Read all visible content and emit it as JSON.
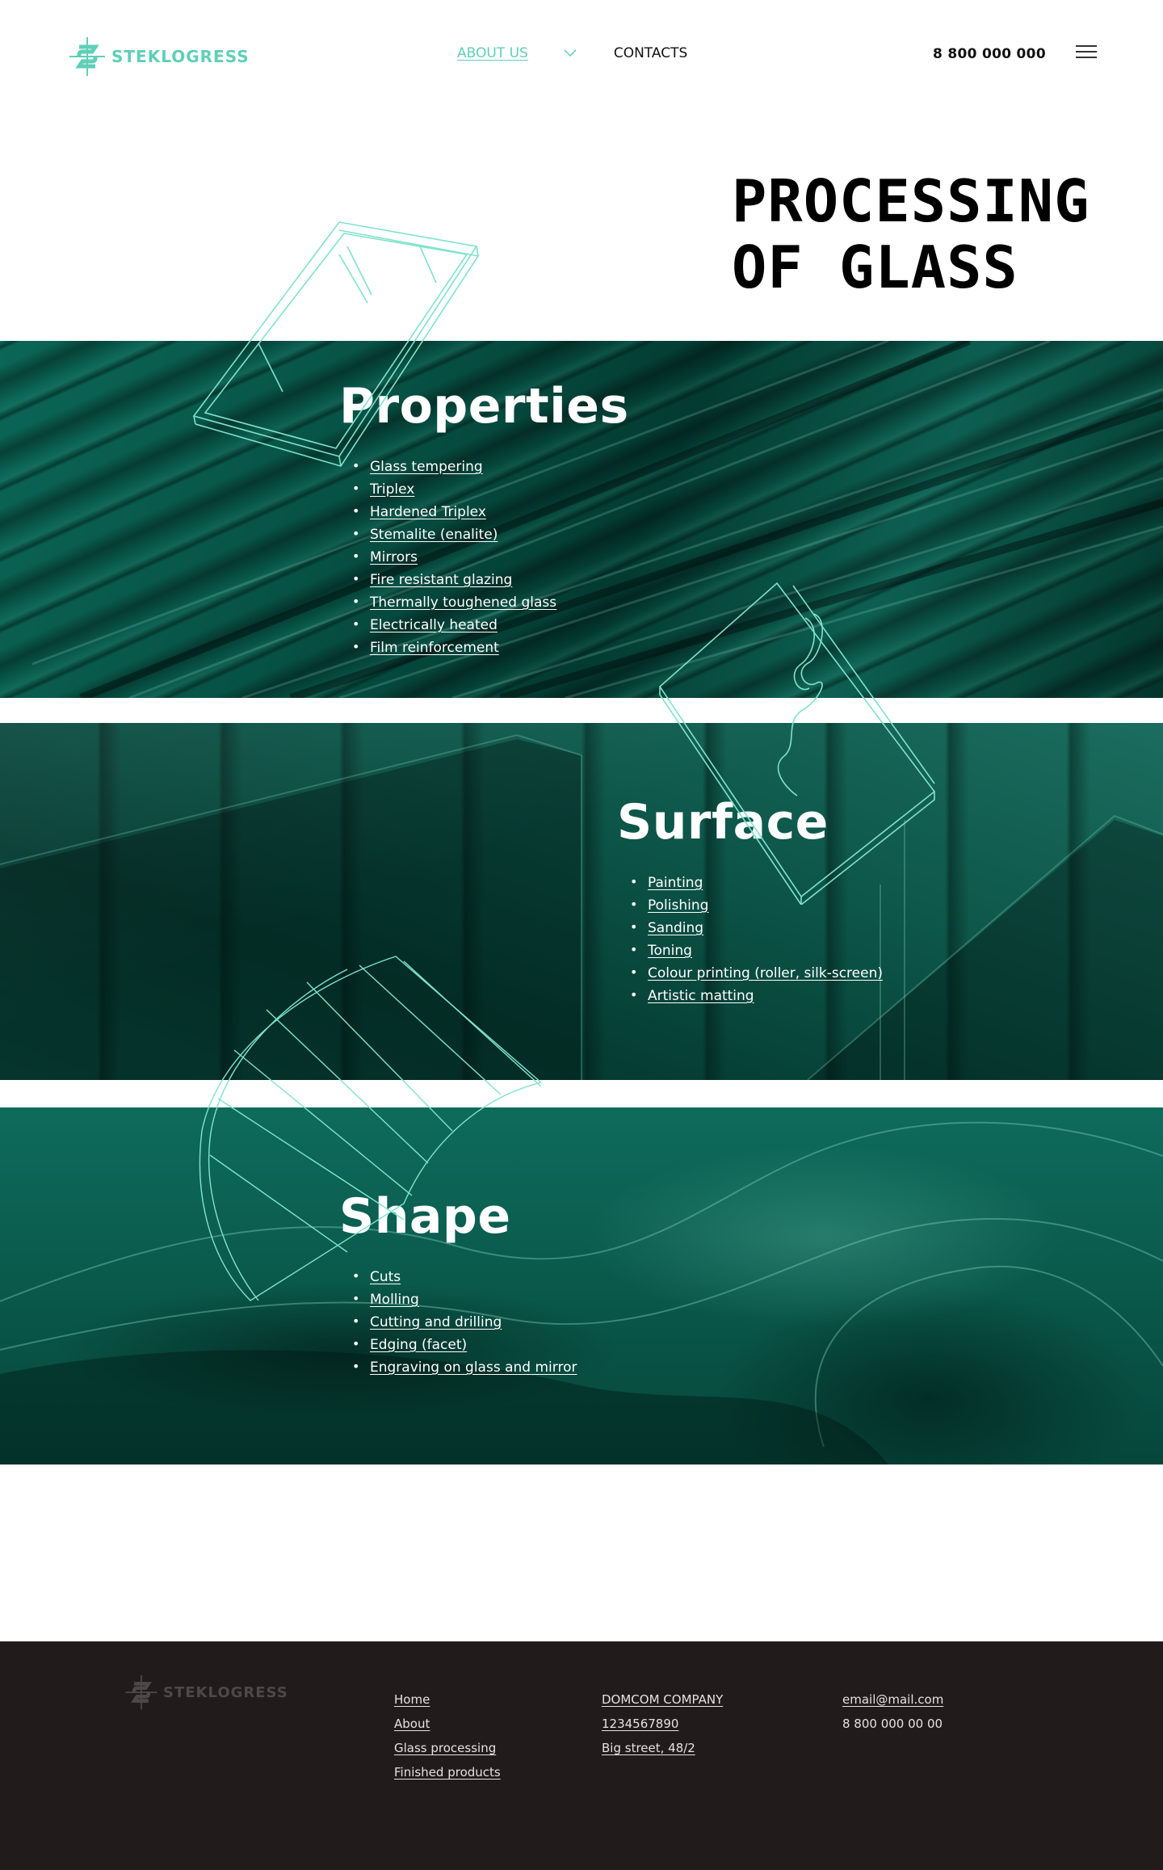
{
  "header": {
    "logo_text": "STEKLOGRESS",
    "nav": {
      "about_label": "ABOUT US",
      "contacts_label": "CONTACTS"
    },
    "phone": "8 800 000 000",
    "menu_icon": "hamburger-icon"
  },
  "hero": {
    "title_line1": "PROCESSING",
    "title_line2": "OF GLASS"
  },
  "sections": {
    "properties": {
      "title": "Properties",
      "items": [
        "Glass tempering",
        "Triplex",
        "Hardened Triplex",
        "Stemalite (enalite)",
        "Mirrors",
        "Fire resistant glazing",
        "Thermally toughened glass",
        "Electrically heated",
        "Film reinforcement"
      ]
    },
    "surface": {
      "title": "Surface",
      "items": [
        "Painting",
        "Polishing",
        "Sanding",
        "Toning",
        "Colour printing (roller, silk-screen)",
        "Artistic matting"
      ]
    },
    "shape": {
      "title": "Shape",
      "items": [
        "Cuts",
        "Molling",
        "Cutting and drilling",
        "Edging (facet)",
        "Engraving on glass and mirror"
      ]
    }
  },
  "footer": {
    "logo_text": "STEKLOGRESS",
    "nav": [
      "Home",
      "About",
      "Glass processing",
      "Finished products"
    ],
    "company": [
      "DOMCOM COMPANY",
      "1234567890",
      "Big street, 48/2"
    ],
    "email": "email@mail.com",
    "phone": "8 800 000 00 00"
  },
  "colors": {
    "accent": "#5fcfb7",
    "section_bg": "#075246",
    "footer_bg": "#221b1c",
    "line_art": "#7fe3cc"
  }
}
